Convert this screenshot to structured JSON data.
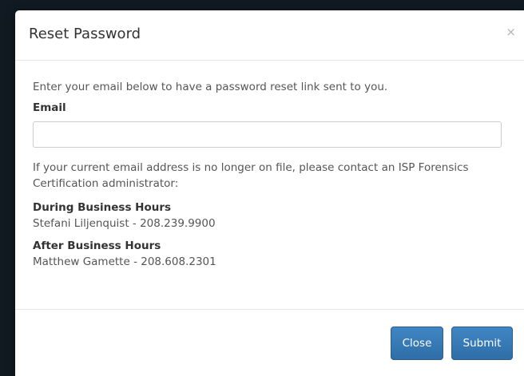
{
  "modal": {
    "title": "Reset Password",
    "close_glyph": "×",
    "intro": "Enter your email below to have a password reset link sent to you.",
    "email_label": "Email",
    "email_value": "",
    "email_placeholder": "",
    "contact_note": "If your current email address is no longer on file, please contact an ISP Forensics Certification administrator:",
    "contacts": [
      {
        "heading": "During Business Hours",
        "contact": "Stefani Liljenquist - 208.239.9900"
      },
      {
        "heading": "After Business Hours",
        "contact": "Matthew Gamette - 208.608.2301"
      }
    ],
    "buttons": {
      "close_label": "Close",
      "submit_label": "Submit"
    }
  },
  "colors": {
    "primary": "#337ab7",
    "backdrop": "#111a22"
  },
  "icons": {
    "close": "close-icon"
  }
}
